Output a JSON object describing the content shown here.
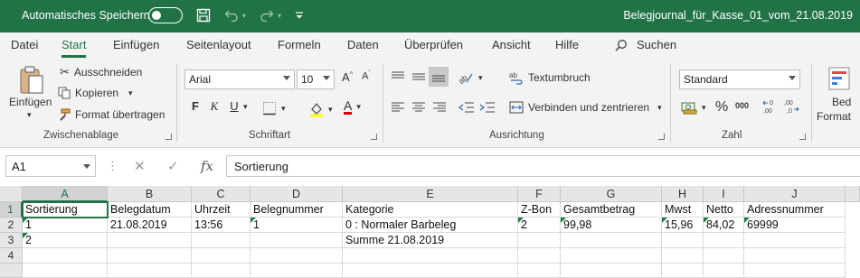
{
  "titlebar": {
    "autosave_label": "Automatisches Speichern",
    "autosave_state": "off",
    "document_title": "Belegjournal_für_Kasse_01_vom_21.08.2019"
  },
  "menu": {
    "tabs": [
      "Datei",
      "Start",
      "Einfügen",
      "Seitenlayout",
      "Formeln",
      "Daten",
      "Überprüfen",
      "Ansicht",
      "Hilfe"
    ],
    "active_tab": "Start",
    "search_label": "Suchen"
  },
  "ribbon": {
    "clipboard": {
      "paste_label": "Einfügen",
      "cut_label": "Ausschneiden",
      "copy_label": "Kopieren",
      "format_painter_label": "Format übertragen",
      "group_label": "Zwischenablage"
    },
    "font": {
      "font_name": "Arial",
      "font_size": "10",
      "bold": "F",
      "italic": "K",
      "underline": "U",
      "group_label": "Schriftart"
    },
    "alignment": {
      "wrap_text_label": "Textumbruch",
      "merge_label": "Verbinden und zentrieren",
      "group_label": "Ausrichtung"
    },
    "number": {
      "format_value": "Standard",
      "group_label": "Zahl"
    },
    "conditional": {
      "label_line1": "Bed",
      "label_line2": "Format"
    }
  },
  "formula_bar": {
    "name_box": "A1",
    "content": "Sortierung"
  },
  "grid": {
    "columns": [
      "A",
      "B",
      "C",
      "D",
      "E",
      "F",
      "G",
      "H",
      "I",
      "J"
    ],
    "rows": [
      "1",
      "2",
      "3",
      "4"
    ],
    "cells": {
      "r1": [
        "Sortierung",
        "Belegdatum",
        "Uhrzeit",
        "Belegnummer",
        "Kategorie",
        "Z-Bon",
        "Gesamtbetrag",
        "Mwst",
        "Netto",
        "Adressnummer"
      ],
      "r2": [
        "1",
        "21.08.2019",
        "13:56",
        "1",
        "0 : Normaler Barbeleg",
        "2",
        "99,98",
        "15,96",
        "84,02",
        "69999"
      ],
      "r3": [
        "2",
        "",
        "",
        "",
        "Summe 21.08.2019",
        "",
        "",
        "",
        "",
        ""
      ],
      "r4": [
        "",
        "",
        "",
        "",
        "",
        "",
        "",
        "",
        "",
        ""
      ]
    }
  },
  "colors": {
    "accent": "#217346",
    "ribbon_bg": "#f3f3f3"
  }
}
